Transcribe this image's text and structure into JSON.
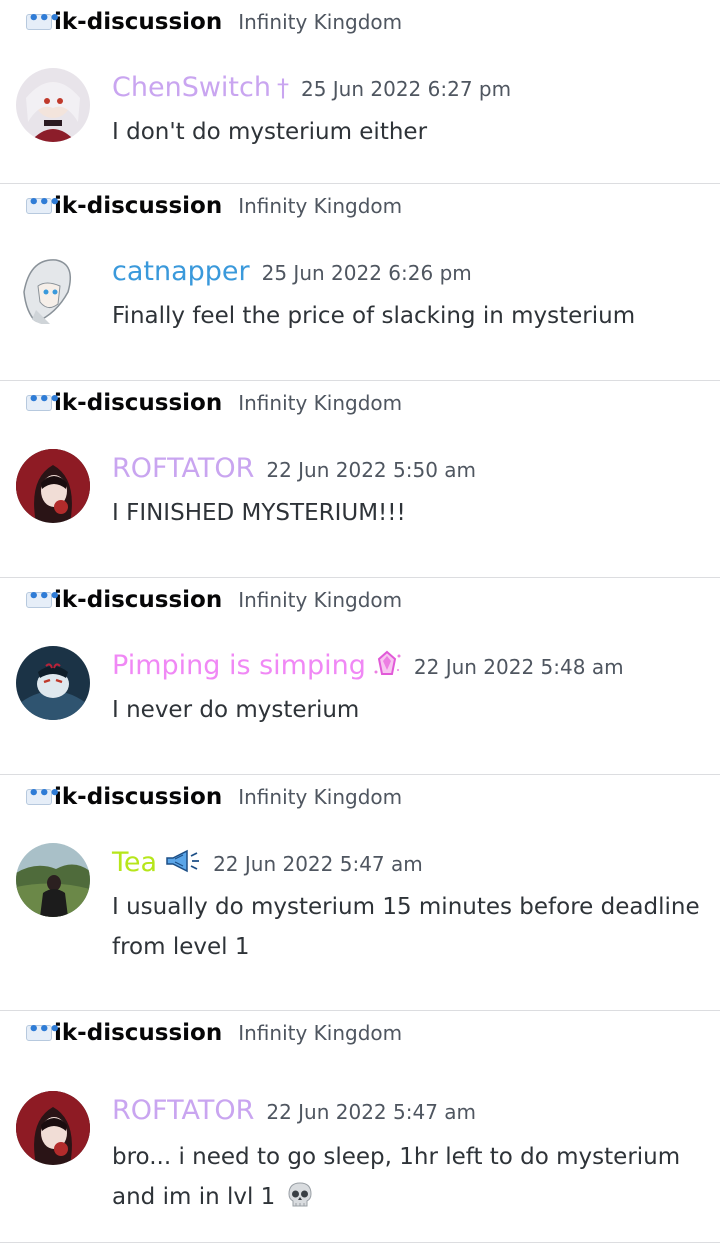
{
  "results": [
    {
      "channel": "ik-discussion",
      "server": "Infinity Kingdom",
      "username": "ChenSwitch",
      "username_color": "#c9a5f0",
      "badge": "†",
      "timestamp": "25 Jun 2022 6:27 pm",
      "content": "I don't do mysterium either",
      "avatar_icon": "anime-girl-avatar"
    },
    {
      "channel": "ik-discussion",
      "server": "Infinity Kingdom",
      "username": "catnapper",
      "username_color": "#3a99db",
      "timestamp": "25 Jun 2022 6:26 pm",
      "content": "Finally feel the price of slacking in mysterium",
      "avatar_icon": "white-hair-avatar"
    },
    {
      "channel": "ik-discussion",
      "server": "Infinity Kingdom",
      "username": "ROFTATOR",
      "username_color": "#c9a5f0",
      "timestamp": "22 Jun 2022 5:50 am",
      "content": "I FINISHED MYSTERIUM!!!",
      "avatar_icon": "red-hood-avatar"
    },
    {
      "channel": "ik-discussion",
      "server": "Infinity Kingdom",
      "username": "Pimping is simping",
      "username_color": "#f088f5",
      "timestamp": "22 Jun 2022 5:48 am",
      "content": "I never do mysterium",
      "avatar_icon": "blue-character-avatar",
      "badge_icon": "gem-icon"
    },
    {
      "channel": "ik-discussion",
      "server": "Infinity Kingdom",
      "username": "Tea",
      "username_color": "#b6e61b",
      "timestamp": "22 Jun 2022 5:47 am",
      "content": "I usually do mysterium 15 minutes before deadline from level 1",
      "avatar_icon": "landscape-person-avatar",
      "badge_icon": "megaphone-icon"
    },
    {
      "channel": "ik-discussion",
      "server": "Infinity Kingdom",
      "username": "ROFTATOR",
      "username_color": "#c9a5f0",
      "timestamp": "22 Jun 2022 5:47 am",
      "content": "bro... i need to go sleep, 1hr left to do mysterium and im in lvl 1",
      "avatar_icon": "red-hood-avatar",
      "trailing_icon": "skull-icon"
    }
  ]
}
